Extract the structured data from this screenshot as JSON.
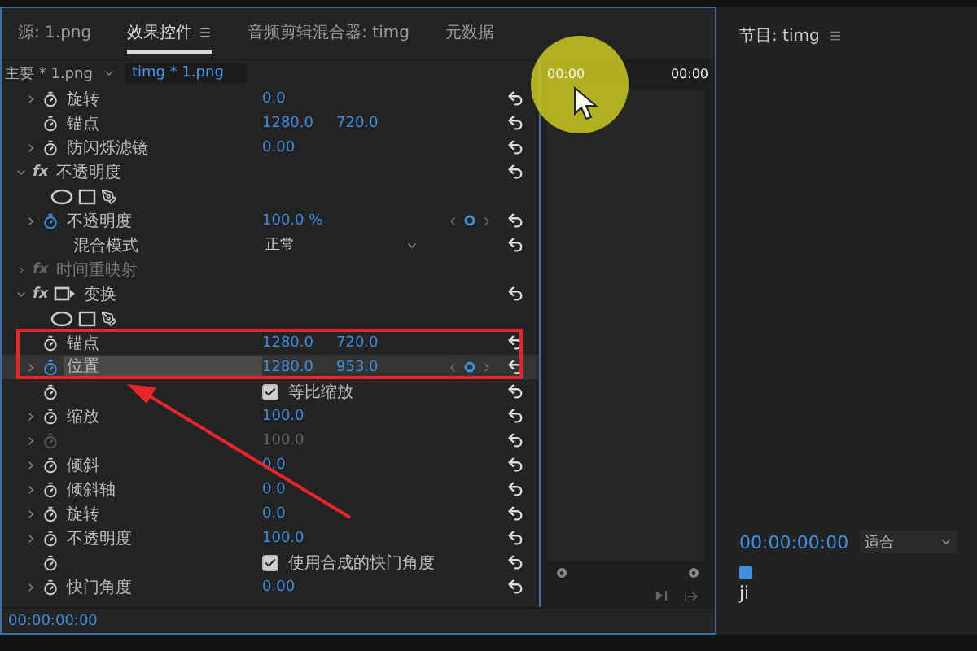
{
  "effect_panel": {
    "tabs": [
      {
        "label": "源: 1.png",
        "selected": false,
        "menu": false
      },
      {
        "label": "效果控件",
        "selected": true,
        "menu": true
      },
      {
        "label": "音频剪辑混合器: timg",
        "selected": false,
        "menu": false
      },
      {
        "label": "元数据",
        "selected": false,
        "menu": false
      }
    ],
    "master_clip": "主要 * 1.png",
    "sequence_clip": "timg * 1.png",
    "rows": [
      {
        "kind": "property",
        "label": "旋转",
        "values": [
          "0.0"
        ],
        "expandable": true,
        "animated": false,
        "keyframes": false,
        "selected": false,
        "disabled": false,
        "reset": true
      },
      {
        "kind": "property",
        "label": "锚点",
        "values": [
          "1280.0",
          "720.0"
        ],
        "expandable": false,
        "animated": false,
        "keyframes": false,
        "selected": false,
        "disabled": false,
        "reset": true
      },
      {
        "kind": "property",
        "label": "防闪烁滤镜",
        "values": [
          "0.00"
        ],
        "expandable": true,
        "animated": false,
        "keyframes": false,
        "selected": false,
        "disabled": false,
        "reset": true
      },
      {
        "kind": "effect",
        "fx": "fx",
        "label": "不透明度",
        "expanded": true,
        "fx_on": true,
        "transform_icon": false,
        "reset": true
      },
      {
        "kind": "masks",
        "reset": false
      },
      {
        "kind": "property",
        "label": "不透明度",
        "values": [
          "100.0 %"
        ],
        "expandable": true,
        "animated": true,
        "keyframes": true,
        "selected": false,
        "disabled": false,
        "reset": true
      },
      {
        "kind": "select",
        "label": "混合模式",
        "value": "正常",
        "reset": true
      },
      {
        "kind": "effect",
        "fx": "fx",
        "label": "时间重映射",
        "expanded": false,
        "fx_on": false,
        "transform_icon": false,
        "reset": false
      },
      {
        "kind": "effect",
        "fx": "fx",
        "label": "变换",
        "expanded": true,
        "fx_on": true,
        "transform_icon": true,
        "reset": true
      },
      {
        "kind": "masks",
        "reset": false
      },
      {
        "kind": "property",
        "label": "锚点",
        "values": [
          "1280.0",
          "720.0"
        ],
        "expandable": false,
        "animated": false,
        "keyframes": false,
        "selected": false,
        "disabled": false,
        "reset": true
      },
      {
        "kind": "property",
        "label": "位置",
        "values": [
          "1280.0",
          "953.0"
        ],
        "expandable": true,
        "animated": true,
        "keyframes": true,
        "selected": true,
        "disabled": false,
        "reset": true
      },
      {
        "kind": "checkbox",
        "label": "等比缩放",
        "checked": true,
        "reset": true
      },
      {
        "kind": "property",
        "label": "缩放",
        "values": [
          "100.0"
        ],
        "expandable": true,
        "animated": false,
        "keyframes": false,
        "selected": false,
        "disabled": false,
        "reset": true
      },
      {
        "kind": "property",
        "label": "",
        "values": [
          "100.0"
        ],
        "expandable": true,
        "animated": false,
        "keyframes": false,
        "selected": false,
        "disabled": true,
        "reset": true
      },
      {
        "kind": "property",
        "label": "倾斜",
        "values": [
          "0.0"
        ],
        "expandable": true,
        "animated": false,
        "keyframes": false,
        "selected": false,
        "disabled": false,
        "reset": true
      },
      {
        "kind": "property",
        "label": "倾斜轴",
        "values": [
          "0.0"
        ],
        "expandable": true,
        "animated": false,
        "keyframes": false,
        "selected": false,
        "disabled": false,
        "reset": true
      },
      {
        "kind": "property",
        "label": "旋转",
        "values": [
          "0.0"
        ],
        "expandable": true,
        "animated": false,
        "keyframes": false,
        "selected": false,
        "disabled": false,
        "reset": true
      },
      {
        "kind": "property",
        "label": "不透明度",
        "values": [
          "100.0"
        ],
        "expandable": true,
        "animated": false,
        "keyframes": false,
        "selected": false,
        "disabled": false,
        "reset": true
      },
      {
        "kind": "checkbox",
        "label": "使用合成的快门角度",
        "checked": true,
        "reset": true
      },
      {
        "kind": "property",
        "label": "快门角度",
        "values": [
          "0.00"
        ],
        "expandable": true,
        "animated": false,
        "keyframes": false,
        "selected": false,
        "disabled": false,
        "reset": true
      }
    ],
    "timeline_ruler": [
      "00:00",
      "00:00"
    ],
    "timecode": "00:00:00:00"
  },
  "program_monitor": {
    "title": "节目: timg",
    "timecode": "00:00:00:00",
    "zoom": "适合",
    "label": "ji"
  }
}
